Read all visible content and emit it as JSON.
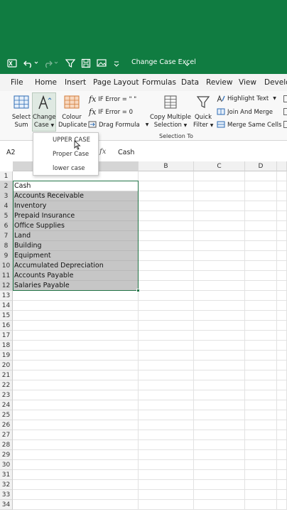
{
  "quick_access": {
    "title": "Change Case Excel",
    "icons": [
      "excel-logo-icon",
      "undo-icon",
      "redo-icon",
      "filter-icon",
      "save-icon",
      "picture-icon",
      "customize-icon"
    ]
  },
  "menu": [
    "File",
    "Home",
    "Insert",
    "Page Layout",
    "Formulas",
    "Data",
    "Review",
    "View",
    "Develo"
  ],
  "ribbon": {
    "select_sum": [
      "Select",
      "Sum"
    ],
    "change_case": [
      "Change",
      "Case"
    ],
    "colour_duplicate": [
      "Colour",
      "Duplicate"
    ],
    "if_error_blank": "IF Error = \" \"",
    "if_error_zero": "IF Error = 0",
    "drag_formula": "Drag Formula",
    "copy_multiple": [
      "Copy Multiple",
      "Selection"
    ],
    "quick_filter": [
      "Quick",
      "Filter"
    ],
    "highlight_text": "Highlight Text",
    "join_merge": "Join And Merge",
    "merge_same": "Merge Same Cells",
    "group_label": "Selection To"
  },
  "change_case_menu": [
    "UPPER CASE",
    "Proper Case",
    "lower  case"
  ],
  "name_box": "A2",
  "formula_value": "Cash",
  "columns": [
    "B",
    "C",
    "D"
  ],
  "rows": [
    "1",
    "2",
    "3",
    "4",
    "5",
    "6",
    "7",
    "8",
    "9",
    "10",
    "11",
    "12",
    "13",
    "14",
    "15",
    "16",
    "17",
    "18",
    "19",
    "20",
    "21",
    "22",
    "23",
    "24",
    "25",
    "26",
    "27",
    "28",
    "29",
    "30",
    "31",
    "32",
    "33",
    "34"
  ],
  "cells_a": [
    "",
    "Cash",
    "Accounts Receivable",
    "Inventory",
    "Prepaid Insurance",
    "Office Supplies",
    "Land",
    "Building",
    "Equipment",
    "Accumulated Depreciation",
    "Accounts Payable",
    "Salaries Payable"
  ],
  "colors": {
    "brand": "#107c41",
    "selection": "#c6c6c6",
    "border": "#217346"
  }
}
